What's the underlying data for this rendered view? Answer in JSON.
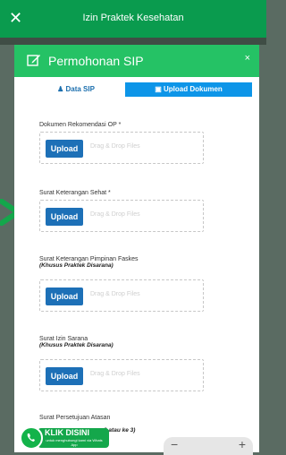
{
  "appbar": {
    "title": "Izin Praktek Kesehatan"
  },
  "modal": {
    "title": "Permohonan SIP",
    "close_label": "×",
    "tabs": [
      {
        "label": "Data SIP"
      },
      {
        "label": "Upload Dokumen"
      }
    ]
  },
  "fields": [
    {
      "label": "Dokumen Rekomendasi OP *",
      "note": "",
      "button": "Upload",
      "drop": "Drag & Drop Files"
    },
    {
      "label": "Surat Keterangan Sehat *",
      "note": "",
      "button": "Upload",
      "drop": "Drag & Drop Files"
    },
    {
      "label": "Surat Keterangan Pimpinan Faskes",
      "note": "(Khusus Praktek Disarana)",
      "button": "Upload",
      "drop": "Drag & Drop Files"
    },
    {
      "label": "Surat Izin Sarana",
      "note": "(Khusus Praktek Disarana)",
      "button": "Upload",
      "drop": "Drag & Drop Files"
    },
    {
      "label": "Surat Persetujuan Atasan",
      "note": "2 atau ke 3)"
    }
  ],
  "whatsapp": {
    "title": "KLIK DISINI",
    "sub": "untuk menghubungi kami via Whats App"
  },
  "zoom": {
    "minus": "−",
    "plus": "+"
  },
  "colors": {
    "header_green": "#25c265",
    "appbar_green": "#0a9b4e",
    "active_tab": "#0d95e8",
    "upload_btn": "#1d70b7"
  }
}
